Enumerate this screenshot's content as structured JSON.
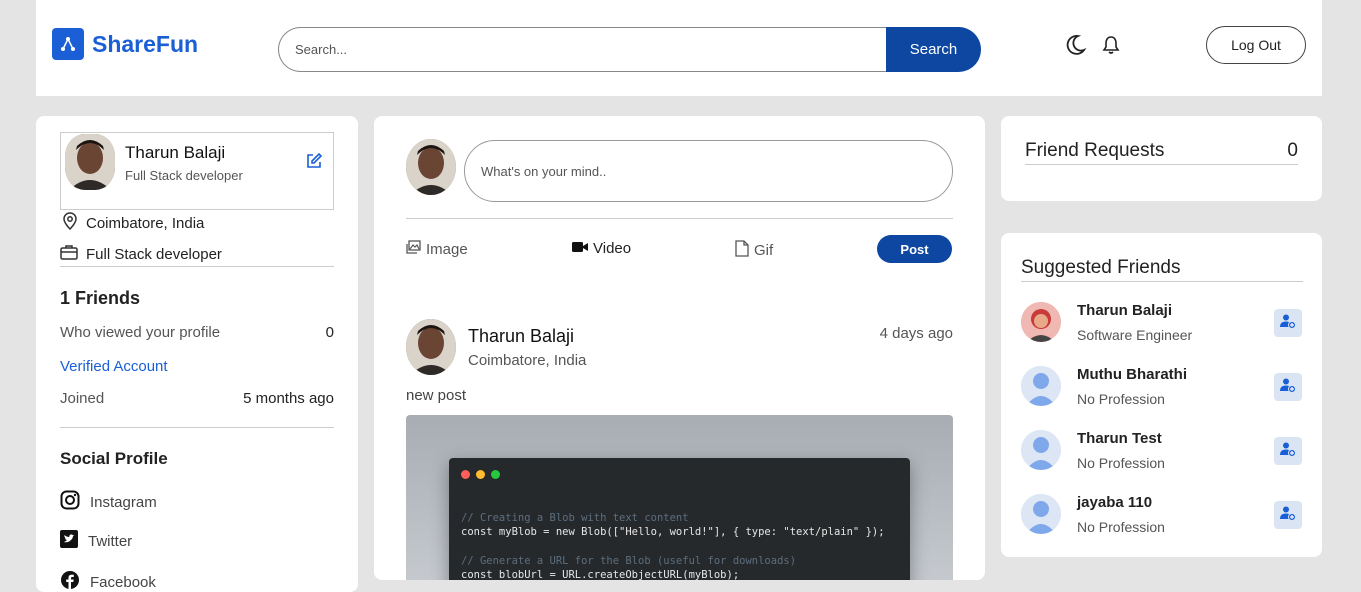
{
  "brand": {
    "name": "ShareFun",
    "color": "#1a5fd6"
  },
  "header": {
    "search_placeholder": "Search...",
    "search_button": "Search",
    "logout_button": "Log Out",
    "theme_icon": "moon-icon",
    "notification_icon": "bell-icon"
  },
  "profile": {
    "name": "Tharun Balaji",
    "title": "Full Stack developer",
    "location": "Coimbatore, India",
    "occupation": "Full Stack developer",
    "friends": "1 Friends",
    "viewed_label": "Who viewed your profile",
    "viewed_count": "0",
    "verified": "Verified Account",
    "joined_label": "Joined",
    "joined_value": "5 months ago",
    "social_title": "Social Profile",
    "social": [
      "Instagram",
      "Twitter",
      "Facebook"
    ]
  },
  "composer": {
    "placeholder": "What's on your mind..",
    "actions": [
      "Image",
      "Video",
      "Gif"
    ],
    "post_button": "Post"
  },
  "post": {
    "author": "Tharun Balaji",
    "location": "Coimbatore, India",
    "time": "4 days ago",
    "text": "new post",
    "code_lines": [
      "// Creating a Blob with text content",
      "const myBlob = new Blob([\"Hello, world!\"], { type: \"text/plain\" });",
      "// Generate a URL for the Blob (useful for downloads)",
      "const blobUrl = URL.createObjectURL(myBlob);"
    ]
  },
  "friend_requests": {
    "label": "Friend Requests",
    "count": "0"
  },
  "suggested": {
    "title": "Suggested Friends",
    "items": [
      {
        "name": "Tharun Balaji",
        "profession": "Software Engineer"
      },
      {
        "name": "Muthu Bharathi",
        "profession": "No Profession"
      },
      {
        "name": "Tharun Test",
        "profession": "No Profession"
      },
      {
        "name": "jayaba 110",
        "profession": "No Profession"
      }
    ]
  },
  "colors": {
    "primary": "#0d47a1",
    "link": "#1a5fd6",
    "background": "#e4e4e4"
  }
}
